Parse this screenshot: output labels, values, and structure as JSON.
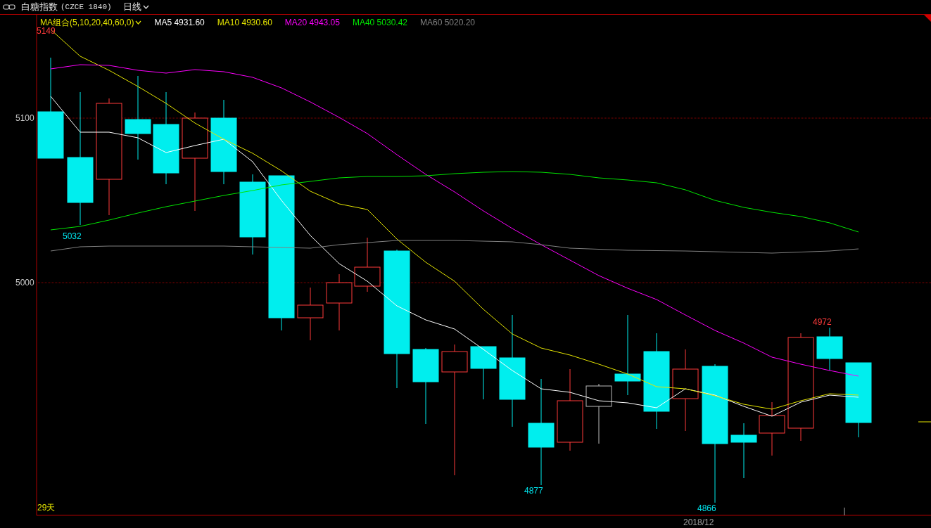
{
  "header": {
    "title": "白糖指数",
    "code": "(CZCE 1840)",
    "period": "日线"
  },
  "ma_legend": {
    "combo": "MA组合(5,10,20,40,60,0)",
    "items": [
      {
        "label": "MA5 4931.60",
        "color": "#ffffff"
      },
      {
        "label": "MA10 4930.60",
        "color": "#e5e500"
      },
      {
        "label": "MA20 4943.05",
        "color": "#ff00ff"
      },
      {
        "label": "MA40 5030.42",
        "color": "#00e600"
      },
      {
        "label": "MA60 5020.20",
        "color": "#808080"
      }
    ]
  },
  "chart": {
    "y_labels": [
      "5100",
      "5000"
    ],
    "price_labels": [
      {
        "text": "5149",
        "kind": "high"
      },
      {
        "text": "5032",
        "kind": "low"
      },
      {
        "text": "4877",
        "kind": "low"
      },
      {
        "text": "4866",
        "kind": "low"
      },
      {
        "text": "4972",
        "kind": "high"
      }
    ],
    "day_count": "29天",
    "date_label": "2018/12"
  }
}
